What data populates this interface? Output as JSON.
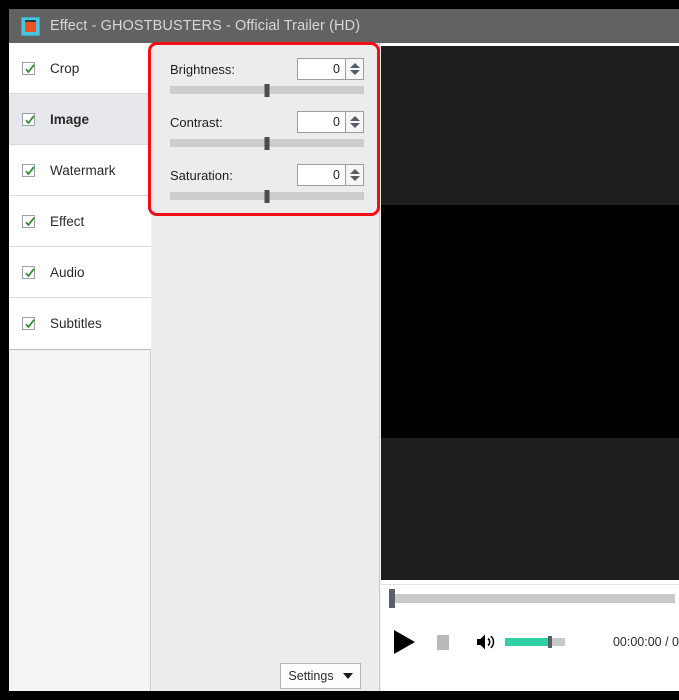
{
  "window": {
    "title": "Effect - GHOSTBUSTERS - Official Trailer (HD)",
    "icon": "film-frame-icon"
  },
  "sidebar": {
    "items": [
      {
        "label": "Crop",
        "checked": true,
        "selected": false
      },
      {
        "label": "Image",
        "checked": true,
        "selected": true
      },
      {
        "label": "Watermark",
        "checked": true,
        "selected": false
      },
      {
        "label": "Effect",
        "checked": true,
        "selected": false
      },
      {
        "label": "Audio",
        "checked": true,
        "selected": false
      },
      {
        "label": "Subtitles",
        "checked": true,
        "selected": false
      }
    ]
  },
  "image_controls": {
    "brightness": {
      "label": "Brightness:",
      "value": "0",
      "slider_percent": 50
    },
    "contrast": {
      "label": "Contrast:",
      "value": "0",
      "slider_percent": 50
    },
    "saturation": {
      "label": "Saturation:",
      "value": "0",
      "slider_percent": 50
    }
  },
  "settings_button": {
    "label": "Settings",
    "chevron": "chevron-down-icon"
  },
  "player": {
    "play_icon": "play-icon",
    "stop_icon": "stop-icon",
    "volume_icon": "speaker-icon",
    "volume_percent": 75,
    "seek_percent": 0,
    "time": "00:00:00 / 0"
  },
  "colors": {
    "titlebar": "#626262",
    "highlight_border": "#f40d12",
    "volume_fill": "#2fd0a5",
    "checkmark": "#2f8b2f",
    "selected_row": "#e6e8eb"
  }
}
